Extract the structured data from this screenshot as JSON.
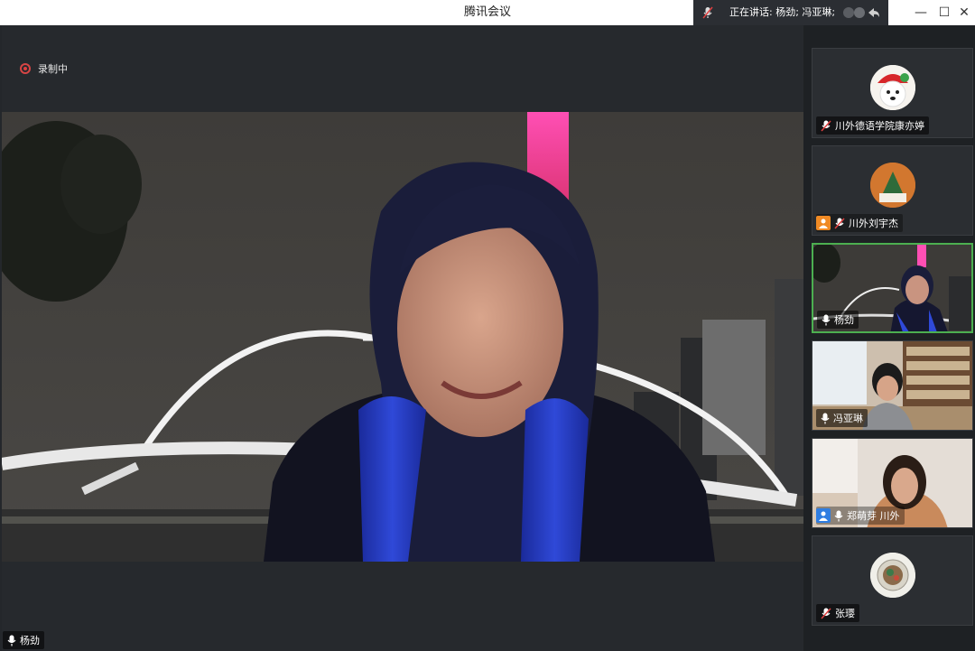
{
  "window": {
    "title": "腾讯会议",
    "speaking_text": "正在讲话: 杨劲; 冯亚琳;",
    "minimize": "—",
    "maximize": "☐",
    "close": "✕"
  },
  "main_view": {
    "recording_label": "录制中",
    "speaker_name": "杨劲"
  },
  "participants": [
    {
      "name": "川外德语学院康亦婷",
      "mic": "muted",
      "badge": null
    },
    {
      "name": "川外刘宇杰",
      "mic": "muted",
      "badge": "host"
    },
    {
      "name": "杨劲",
      "mic": "on",
      "badge": null,
      "active": true
    },
    {
      "name": "冯亚琳",
      "mic": "on",
      "badge": null
    },
    {
      "name": "郑萌芽 川外",
      "mic": "on",
      "badge": "cohost"
    },
    {
      "name": "张璎",
      "mic": "muted",
      "badge": null
    }
  ],
  "colors": {
    "titlebar_bg": "#ffffff",
    "app_bg": "#24272b",
    "active_border": "#4caf50",
    "recording_red": "#d64545",
    "host_badge": "#f08a24",
    "cohost_badge": "#2f7de1"
  }
}
